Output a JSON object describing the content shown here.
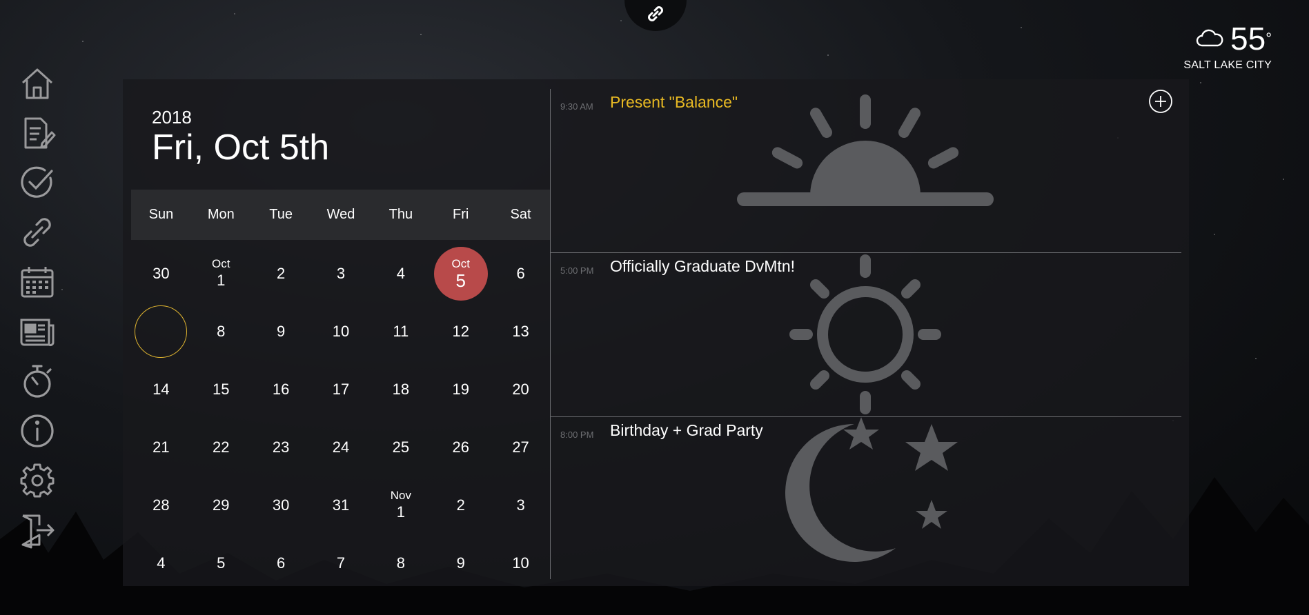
{
  "weather": {
    "icon": "cloud-icon",
    "temperature": "55",
    "degree_symbol": "°",
    "city": "SALT LAKE CITY"
  },
  "top_link": {
    "icon": "link-icon"
  },
  "sidebar": {
    "items": [
      {
        "name": "home",
        "icon": "home-icon"
      },
      {
        "name": "notes",
        "icon": "notes-icon"
      },
      {
        "name": "tasks",
        "icon": "check-icon"
      },
      {
        "name": "links",
        "icon": "link-icon"
      },
      {
        "name": "calendar",
        "icon": "calendar-icon"
      },
      {
        "name": "news",
        "icon": "news-icon"
      },
      {
        "name": "timer",
        "icon": "stopwatch-icon"
      },
      {
        "name": "info",
        "icon": "info-icon"
      },
      {
        "name": "settings",
        "icon": "gear-icon"
      },
      {
        "name": "logout",
        "icon": "logout-icon"
      }
    ]
  },
  "calendar": {
    "year": "2018",
    "date_label": "Fri, Oct 5th",
    "weekdays": [
      "Sun",
      "Mon",
      "Tue",
      "Wed",
      "Thu",
      "Fri",
      "Sat"
    ],
    "weeks": [
      [
        {
          "d": "30"
        },
        {
          "m": "Oct",
          "d": "1"
        },
        {
          "d": "2"
        },
        {
          "d": "3"
        },
        {
          "d": "4"
        },
        {
          "m": "Oct",
          "d": "5",
          "selected": true
        },
        {
          "d": "6"
        }
      ],
      [
        {
          "d": "",
          "ring": true
        },
        {
          "d": "8"
        },
        {
          "d": "9"
        },
        {
          "d": "10"
        },
        {
          "d": "11"
        },
        {
          "d": "12"
        },
        {
          "d": "13"
        }
      ],
      [
        {
          "d": "14"
        },
        {
          "d": "15"
        },
        {
          "d": "16"
        },
        {
          "d": "17"
        },
        {
          "d": "18"
        },
        {
          "d": "19"
        },
        {
          "d": "20"
        }
      ],
      [
        {
          "d": "21"
        },
        {
          "d": "22"
        },
        {
          "d": "23"
        },
        {
          "d": "24"
        },
        {
          "d": "25"
        },
        {
          "d": "26"
        },
        {
          "d": "27"
        }
      ],
      [
        {
          "d": "28"
        },
        {
          "d": "29"
        },
        {
          "d": "30"
        },
        {
          "d": "31"
        },
        {
          "m": "Nov",
          "d": "1"
        },
        {
          "d": "2"
        },
        {
          "d": "3"
        }
      ],
      [
        {
          "d": "4"
        },
        {
          "d": "5"
        },
        {
          "d": "6"
        },
        {
          "d": "7"
        },
        {
          "d": "8"
        },
        {
          "d": "9"
        },
        {
          "d": "10"
        }
      ]
    ],
    "selected_color": "#b84a4a",
    "ring_color": "#e0b530"
  },
  "events": [
    {
      "time": "9:30 AM",
      "title": "Present \"Balance\"",
      "title_color": "#e8b923",
      "art": "sunrise-icon"
    },
    {
      "time": "5:00 PM",
      "title": "Officially Graduate DvMtn!",
      "title_color": "#ffffff",
      "art": "sun-icon"
    },
    {
      "time": "8:00 PM",
      "title": "Birthday + Grad Party",
      "title_color": "#ffffff",
      "art": "moon-stars-icon"
    }
  ],
  "add_event": {
    "icon": "plus-circle-icon"
  }
}
